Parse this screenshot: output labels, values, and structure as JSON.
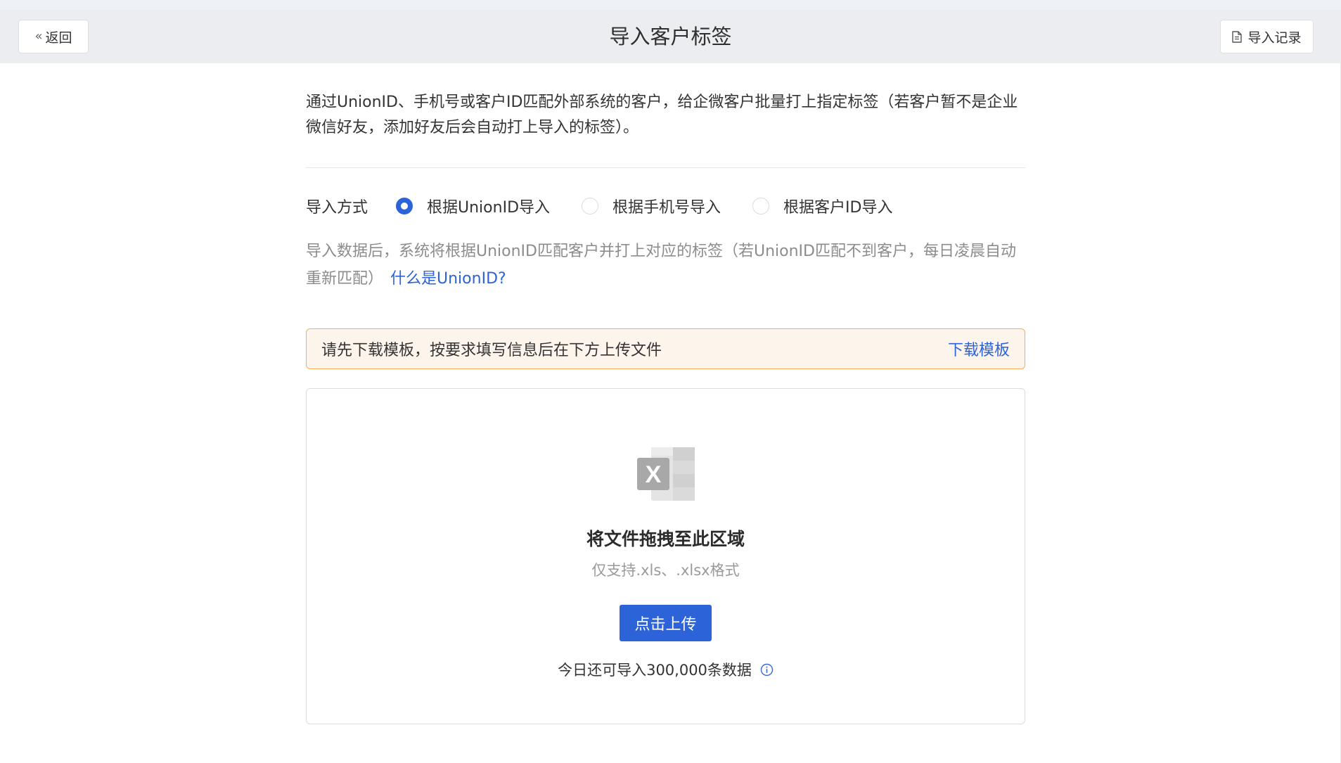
{
  "header": {
    "back_label": "返回",
    "title": "导入客户标签",
    "records_label": "导入记录"
  },
  "intro": "通过UnionID、手机号或客户ID匹配外部系统的客户，给企微客户批量打上指定标签（若客户暂不是企业微信好友，添加好友后会自动打上导入的标签）。",
  "import_method": {
    "label": "导入方式",
    "options": [
      {
        "label": "根据UnionID导入",
        "checked": true
      },
      {
        "label": "根据手机号导入",
        "checked": false
      },
      {
        "label": "根据客户ID导入",
        "checked": false
      }
    ],
    "hint": "导入数据后，系统将根据UnionID匹配客户并打上对应的标签（若UnionID匹配不到客户，每日凌晨自动重新匹配）",
    "hint_link": "什么是UnionID?"
  },
  "notice": {
    "text": "请先下载模板，按要求填写信息后在下方上传文件",
    "link": "下载模板"
  },
  "dropzone": {
    "title": "将文件拖拽至此区域",
    "formats": "仅支持.xls、.xlsx格式",
    "upload_label": "点击上传",
    "quota": "今日还可导入300,000条数据"
  },
  "colors": {
    "accent": "#2d63d9",
    "notice_border": "#f4ad5a",
    "notice_bg": "#fdf5ec",
    "header_bg": "#ecedf0"
  },
  "icons": {
    "back": "double-chevron-left-icon",
    "records": "document-icon",
    "file": "excel-file-icon",
    "info": "info-circle-icon"
  }
}
